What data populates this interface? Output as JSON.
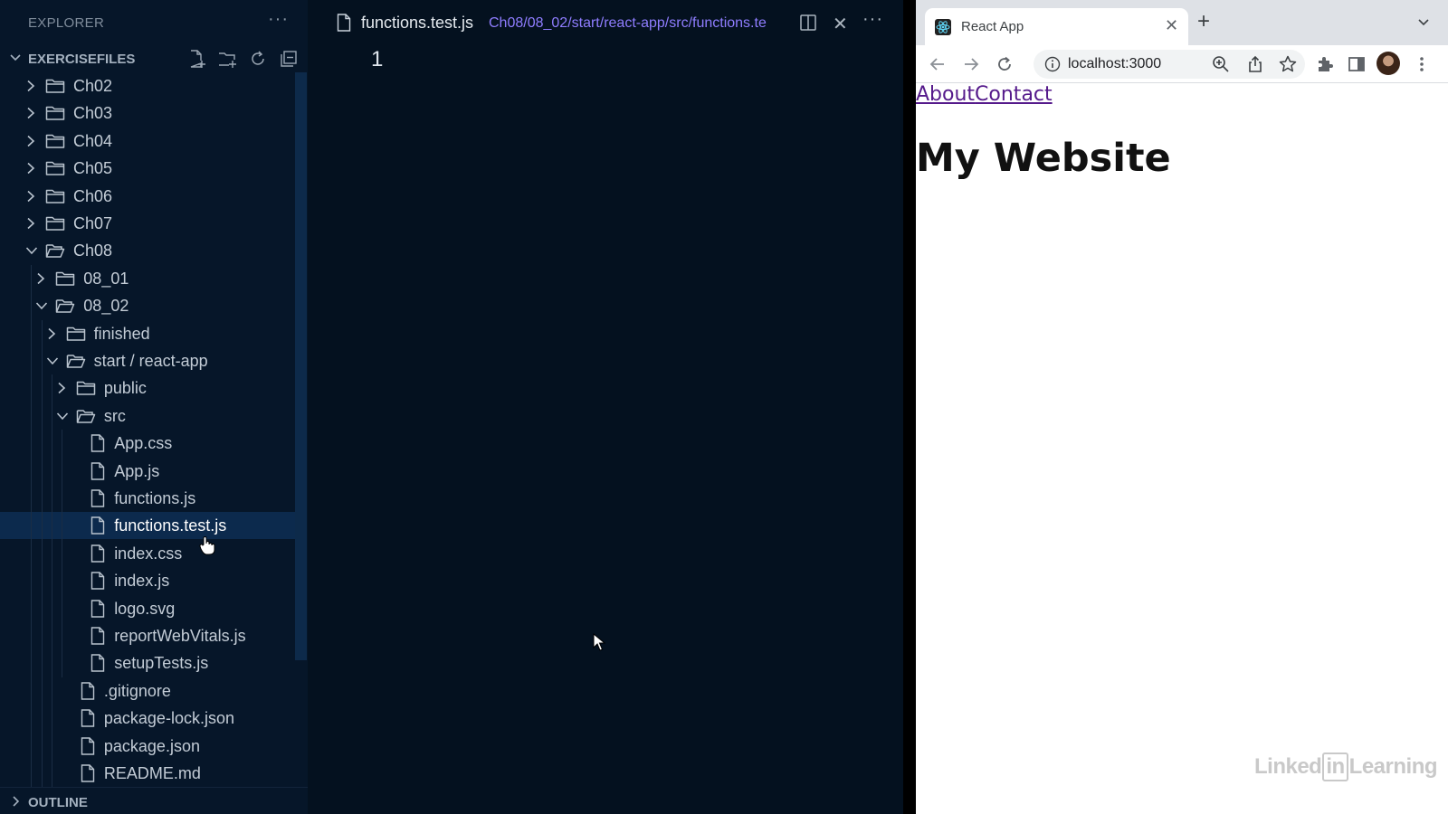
{
  "vscode": {
    "explorer_title": "EXPLORER",
    "more": "···",
    "workspace": "EXERCISEFILES",
    "outline": "OUTLINE",
    "tree": [
      {
        "label": "Ch02",
        "kind": "folder",
        "open": false
      },
      {
        "label": "Ch03",
        "kind": "folder",
        "open": false
      },
      {
        "label": "Ch04",
        "kind": "folder",
        "open": false
      },
      {
        "label": "Ch05",
        "kind": "folder",
        "open": false
      },
      {
        "label": "Ch06",
        "kind": "folder",
        "open": false
      },
      {
        "label": "Ch07",
        "kind": "folder",
        "open": false
      },
      {
        "label": "Ch08",
        "kind": "folder",
        "open": true
      },
      {
        "label": "08_01",
        "kind": "folder",
        "open": false
      },
      {
        "label": "08_02",
        "kind": "folder",
        "open": true
      },
      {
        "label": "finished",
        "kind": "folder",
        "open": false
      },
      {
        "label": "start / react-app",
        "kind": "folder",
        "open": true
      },
      {
        "label": "public",
        "kind": "folder",
        "open": false
      },
      {
        "label": "src",
        "kind": "folder",
        "open": true
      },
      {
        "label": "App.css",
        "kind": "file"
      },
      {
        "label": "App.js",
        "kind": "file"
      },
      {
        "label": "functions.js",
        "kind": "file"
      },
      {
        "label": "functions.test.js",
        "kind": "file",
        "selected": true
      },
      {
        "label": "index.css",
        "kind": "file"
      },
      {
        "label": "index.js",
        "kind": "file"
      },
      {
        "label": "logo.svg",
        "kind": "file"
      },
      {
        "label": "reportWebVitals.js",
        "kind": "file"
      },
      {
        "label": "setupTests.js",
        "kind": "file"
      },
      {
        "label": ".gitignore",
        "kind": "file"
      },
      {
        "label": "package-lock.json",
        "kind": "file"
      },
      {
        "label": "package.json",
        "kind": "file"
      },
      {
        "label": "README.md",
        "kind": "file"
      }
    ],
    "editor": {
      "tab_name": "functions.test.js",
      "tab_path": "Ch08/08_02/start/react-app/src/functions.te",
      "close": "✕",
      "line_number": "1"
    }
  },
  "browser": {
    "tab_title": "React App",
    "tab_close": "✕",
    "new_tab": "+",
    "url": "localhost:3000",
    "links": {
      "about": "About",
      "contact": "Contact"
    },
    "heading": "My Website"
  },
  "watermark": {
    "left": "Linked",
    "box": "in",
    "right": "Learning"
  },
  "colors": {
    "editor_bg": "#04111f",
    "sidebar_bg": "#061629",
    "selection": "#0c2a4d",
    "path_accent": "#8f7dff",
    "visited_link": "#551a8b"
  }
}
